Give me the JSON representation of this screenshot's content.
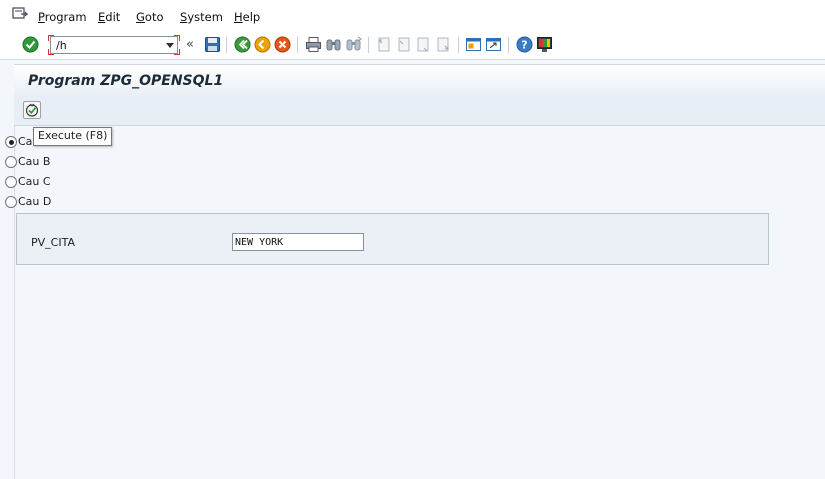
{
  "menubar": {
    "items": [
      {
        "underline": "P",
        "rest": "rogram"
      },
      {
        "underline": "E",
        "rest": "dit"
      },
      {
        "underline": "G",
        "rest": "oto"
      },
      {
        "underline": "S",
        "rest": "ystem"
      },
      {
        "underline": "H",
        "rest": "elp"
      }
    ]
  },
  "toolbar": {
    "command_value": "/h",
    "chevron": "«",
    "icons": [
      "enter-icon",
      "save-icon",
      "back-icon",
      "exit-icon",
      "cancel-icon",
      "print-icon",
      "find-icon",
      "find-next-icon",
      "first-page-icon",
      "previous-page-icon",
      "next-page-icon",
      "last-page-icon",
      "create-session-icon",
      "shortcut-icon",
      "help-icon",
      "customize-layout-icon"
    ]
  },
  "title": "Program ZPG_OPENSQL1",
  "app_toolbar": {
    "execute_icon": "execute-icon",
    "tooltip": "Execute   (F8)"
  },
  "radios": [
    {
      "label": "Cau A",
      "selected": true
    },
    {
      "label": "Cau B",
      "selected": false
    },
    {
      "label": "Cau C",
      "selected": false
    },
    {
      "label": "Cau D",
      "selected": false
    }
  ],
  "parameter": {
    "label": "PV_CITA",
    "value": "NEW YORK"
  },
  "colors": {
    "background": "#f3f6fa",
    "title_gradient_end": "#e9eef4",
    "group_border": "#b7c4d2",
    "command_corner": "#dd3333"
  }
}
